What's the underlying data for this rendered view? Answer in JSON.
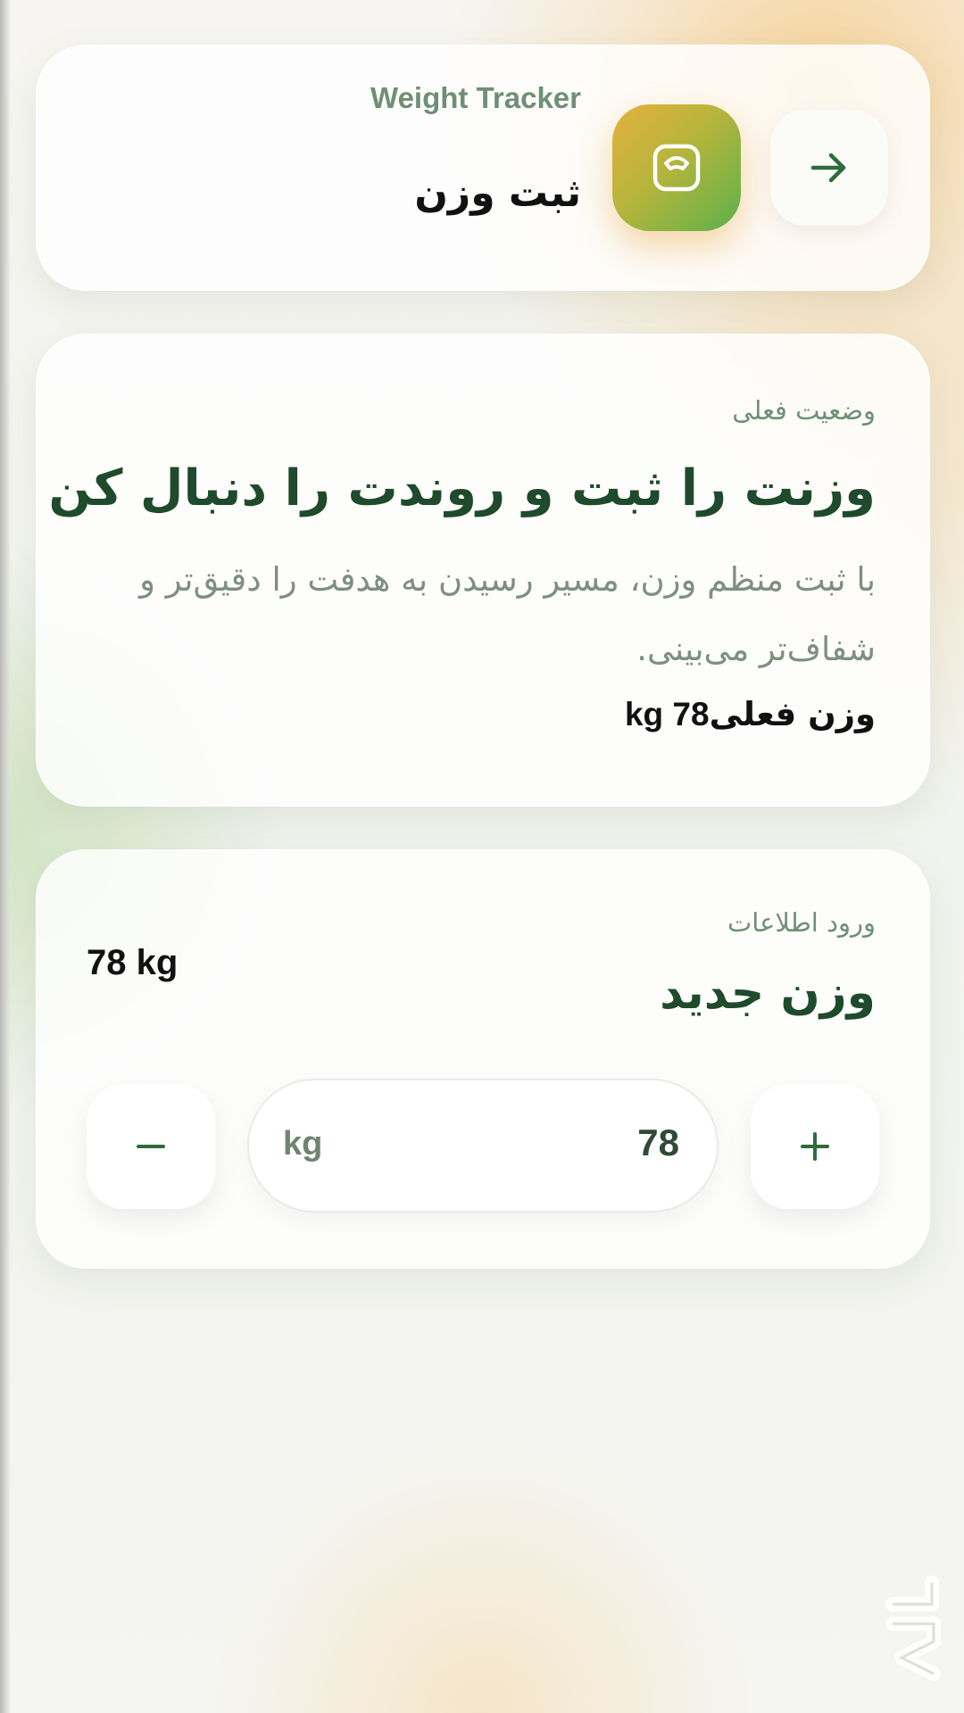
{
  "header": {
    "app_name_en": "Weight Tracker",
    "title": "ثبت وزن",
    "scale_icon": "scale-icon",
    "back_icon": "arrow-right-icon"
  },
  "status": {
    "label": "وضعیت فعلی",
    "headline": "وزنت را ثبت و روندت را دنبال کن",
    "description": "با ثبت منظم وزن، مسیر رسیدن به هدفت را دقیق‌تر و شفاف‌تر می‌بینی.",
    "current_weight_label": "وزن فعلی",
    "current_weight_value": "78 kg"
  },
  "entry": {
    "label": "ورود اطلاعات",
    "title": "وزن جدید",
    "weight_display": "78 kg",
    "field_value": "78",
    "field_unit": "kg",
    "minus_icon": "minus-icon",
    "plus_icon": "plus-icon"
  },
  "colors": {
    "accent_green": "#1f4a2c",
    "muted_green": "#6f8f76",
    "badge_gradient_start": "#e4b23e",
    "badge_gradient_end": "#5cb24a"
  }
}
